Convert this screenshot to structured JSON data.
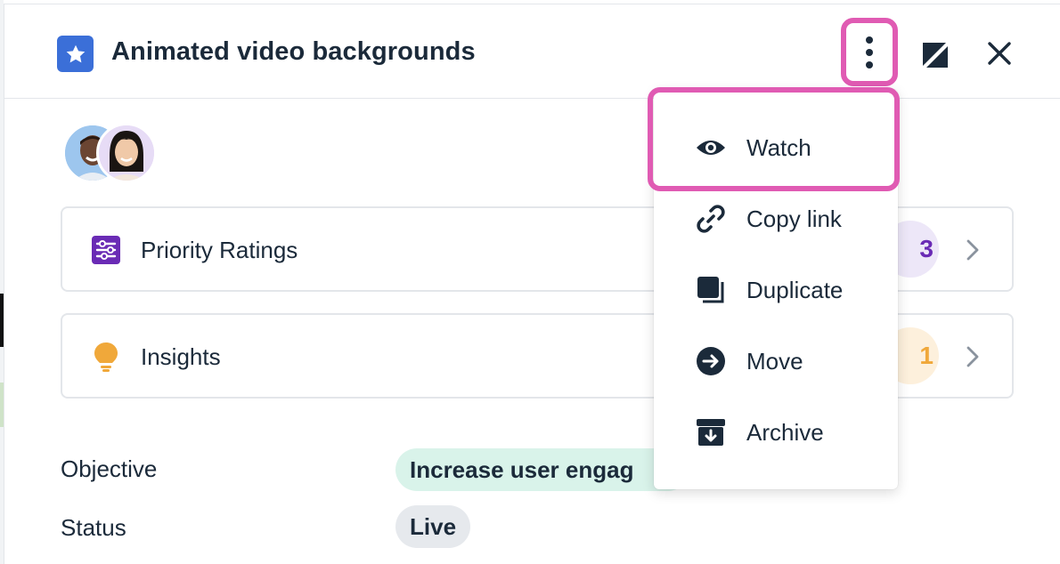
{
  "header": {
    "title": "Animated video backgrounds",
    "title_icon": "star-icon",
    "actions": {
      "more": "more-vertical-icon",
      "expand": "expand-icon",
      "close": "close-icon"
    }
  },
  "members": [
    "avatar-man",
    "avatar-woman"
  ],
  "cards": [
    {
      "label": "Priority Ratings",
      "icon": "sliders-icon",
      "count": "3",
      "accent": "#6a2bb5"
    },
    {
      "label": "Insights",
      "icon": "lightbulb-icon",
      "count": "1",
      "accent": "#f0a83a"
    }
  ],
  "properties": [
    {
      "label": "Objective",
      "value": "Increase user engag"
    },
    {
      "label": "Status",
      "value": "Live"
    }
  ],
  "menu": {
    "items": [
      {
        "label": "Watch",
        "icon": "eye-icon"
      },
      {
        "label": "Copy link",
        "icon": "link-icon"
      },
      {
        "label": "Duplicate",
        "icon": "duplicate-icon"
      },
      {
        "label": "Move",
        "icon": "arrow-right-circle-icon"
      },
      {
        "label": "Archive",
        "icon": "archive-icon"
      }
    ]
  },
  "colors": {
    "highlight": "#e05bb3",
    "brand": "#3b6fd8",
    "text": "#1b2a3a"
  }
}
